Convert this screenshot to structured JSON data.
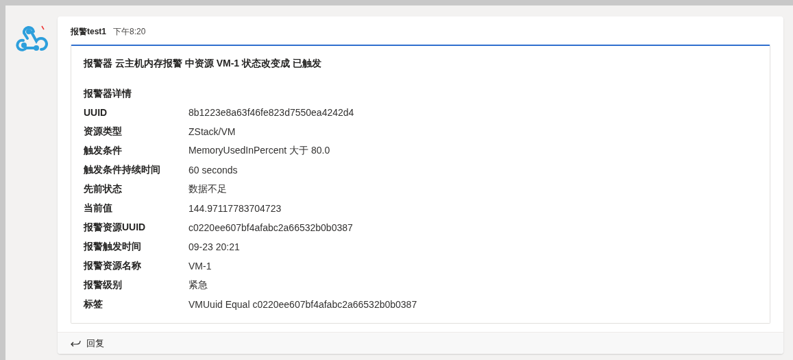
{
  "message": {
    "sender": "报警test1",
    "time": "下午8:20"
  },
  "card": {
    "title": "报警器 云主机内存报警 中资源 VM-1 状态改变成 已触发",
    "section": "报警器详情",
    "rows": [
      {
        "label": "UUID",
        "value": "8b1223e8a63f46fe823d7550ea4242d4"
      },
      {
        "label": "资源类型",
        "value": "ZStack/VM"
      },
      {
        "label": "触发条件",
        "value": "MemoryUsedInPercent 大于 80.0"
      },
      {
        "label": "触发条件持续时间",
        "value": "60 seconds"
      },
      {
        "label": "先前状态",
        "value": "数据不足"
      },
      {
        "label": "当前值",
        "value": "144.97117783704723"
      },
      {
        "label": "报警资源UUID",
        "value": "c0220ee607bf4afabc2a66532b0b0387"
      },
      {
        "label": "报警触发时间",
        "value": "09-23 20:21"
      },
      {
        "label": "报警资源名称",
        "value": "VM-1"
      },
      {
        "label": "报警级别",
        "value": "紧急"
      },
      {
        "label": "标签",
        "value": "VMUuid Equal c0220ee607bf4afabc2a66532b0b0387"
      }
    ]
  },
  "reply": {
    "label": "回复"
  }
}
